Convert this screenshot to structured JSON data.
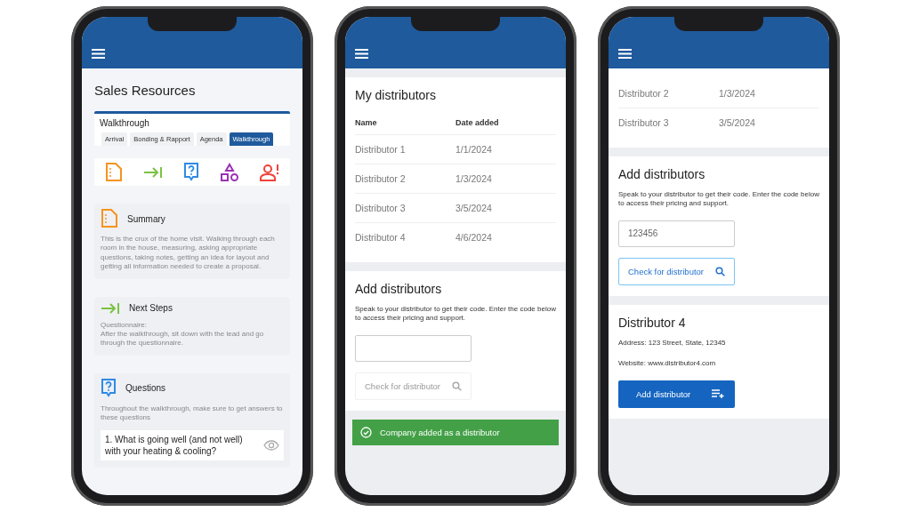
{
  "phones": [
    {
      "kind": "resources",
      "title": "Sales Resources",
      "section": {
        "title": "Walkthrough",
        "tabs": [
          {
            "label": "Arrival",
            "selected": false
          },
          {
            "label": "Bonding & Rapport",
            "selected": false
          },
          {
            "label": "Agenda",
            "selected": false
          },
          {
            "label": "Walkthrough",
            "selected": true
          }
        ]
      },
      "cards": [
        {
          "kind": "text",
          "title": "Summary",
          "body": "This is the crux of the home visit. Walking through each room in the house, measuring, asking appropriate questions, taking notes, getting an idea for layout and getting all information needed to create a proposal."
        },
        {
          "kind": "text",
          "title": "Next Steps",
          "subtitle": "Questionnaire:",
          "body": "After the walkthrough, sit down with the lead and go through the questionnaire."
        },
        {
          "kind": "questions",
          "title": "Questions",
          "body": "Throughout the walkthrough, make sure to get answers to these questions",
          "questions": [
            "1. What is going well (and not well) with your heating & cooling?"
          ]
        }
      ]
    },
    {
      "kind": "distributors",
      "table": {
        "title": "My distributors",
        "columns": [
          "Name",
          "Date added"
        ],
        "rows": [
          [
            "Distributor 1",
            "1/1/2024"
          ],
          [
            "Distributor 2",
            "1/3/2024"
          ],
          [
            "Distributor 3",
            "3/5/2024"
          ],
          [
            "Distributor 4",
            "4/6/2024"
          ]
        ]
      },
      "add": {
        "title": "Add distributors",
        "text": "Speak to your distributor to get their code. Enter the code below to access their pricing and support.",
        "button": {
          "label": "Check for distributor",
          "disabled": true
        }
      },
      "toast": "Company added as a distributor"
    },
    {
      "kind": "distributors",
      "table": {
        "rows": [
          [
            "Distributor 2",
            "1/3/2024"
          ],
          [
            "Distributor 3",
            "3/5/2024"
          ]
        ]
      },
      "add": {
        "title": "Add distributors",
        "text": "Speak to your distributor to get their code. Enter the code below to access their pricing and support.",
        "value": "123456",
        "button": {
          "label": "Check for distributor",
          "disabled": false
        }
      },
      "details": {
        "title": "Distributor 4",
        "lines": [
          "Address: 123 Street, State, 12345",
          "Website: www.distributor4.com"
        ],
        "button": "Add distributor"
      }
    }
  ]
}
